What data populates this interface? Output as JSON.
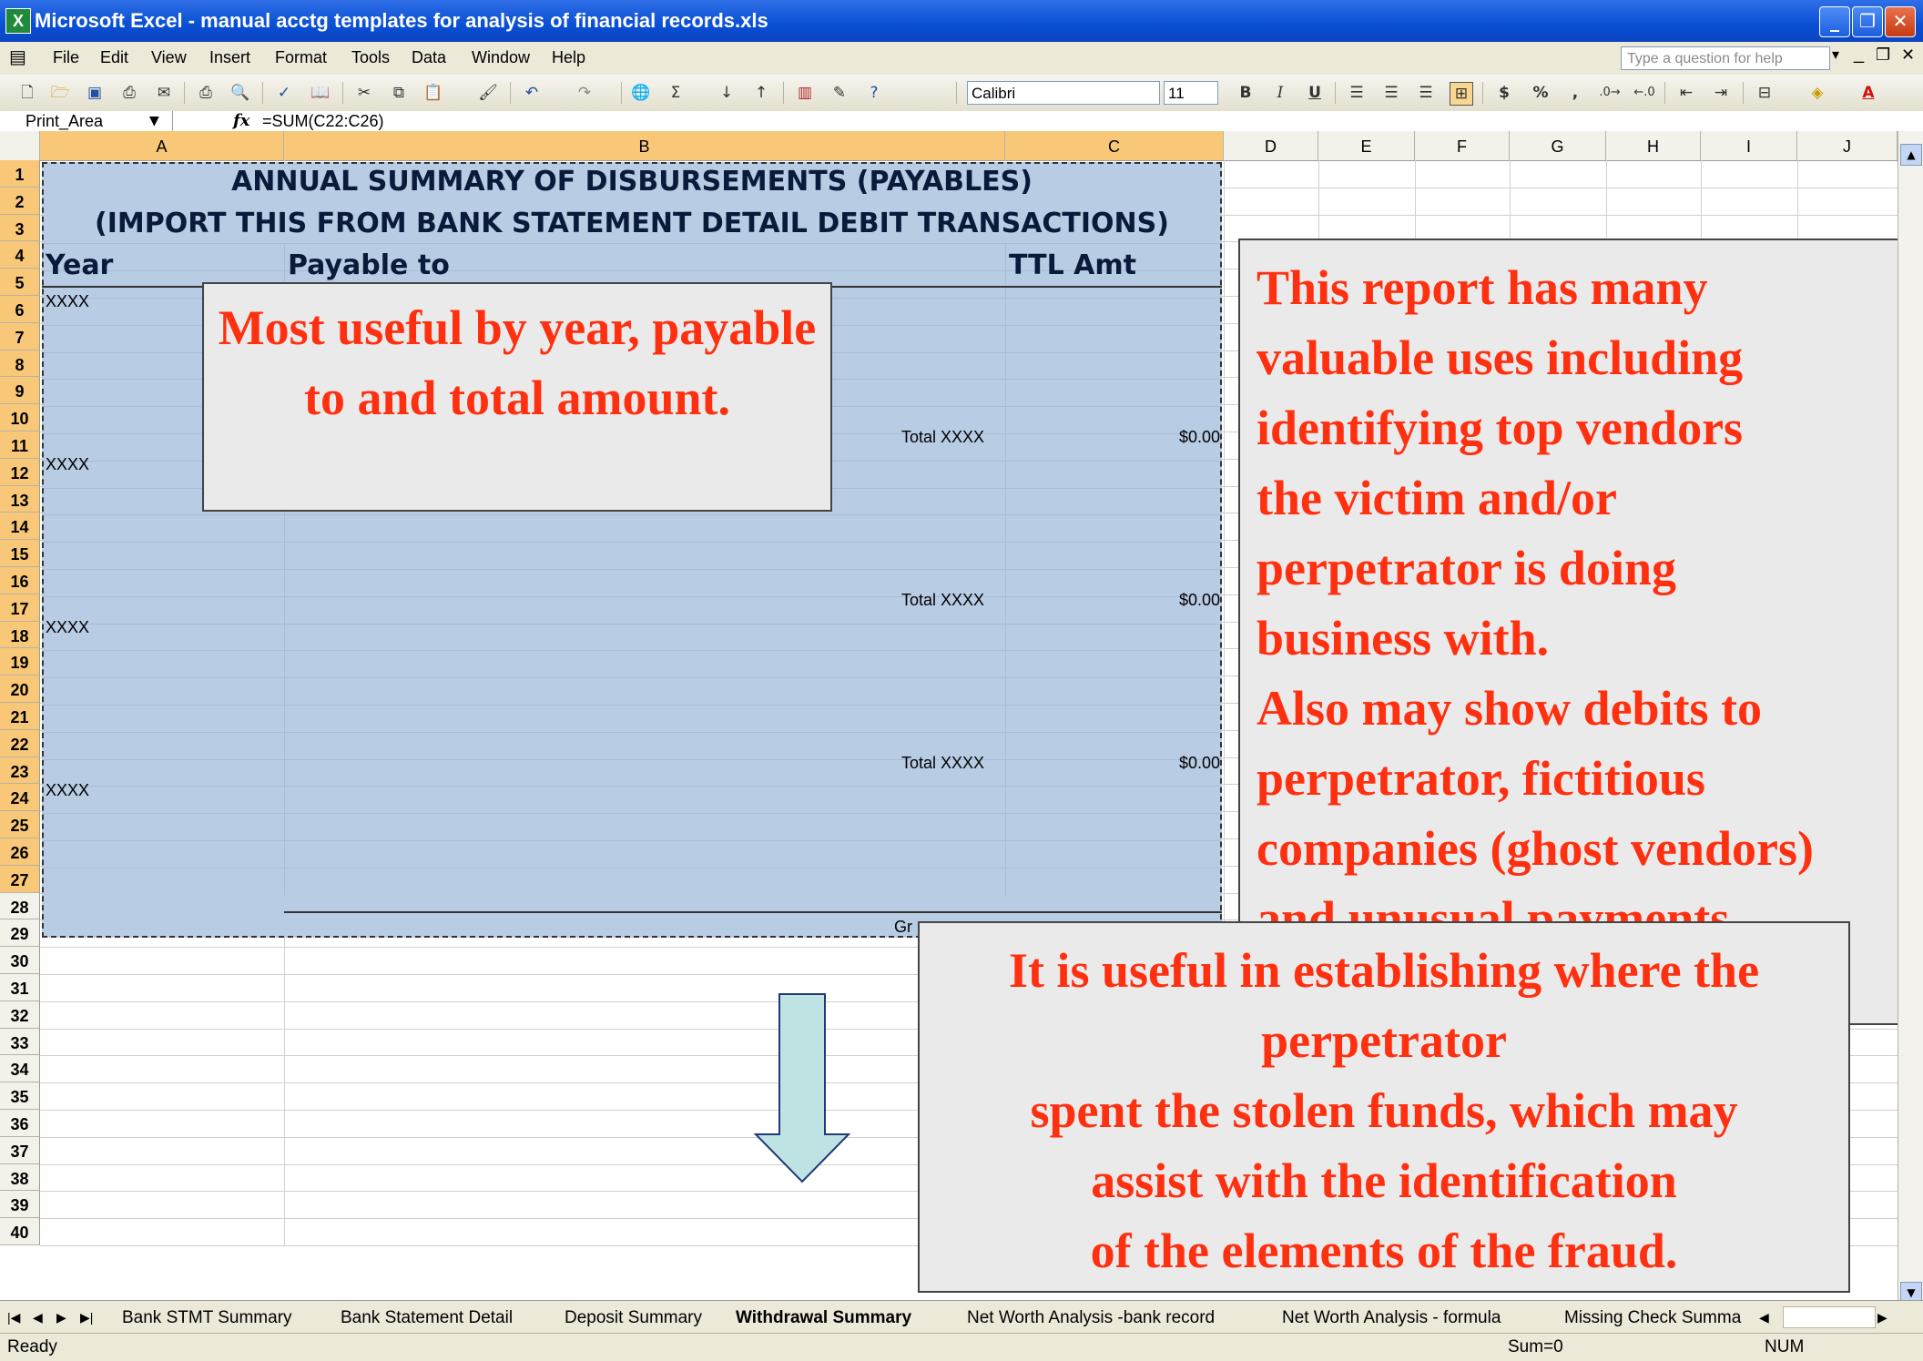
{
  "window": {
    "title": "Microsoft Excel - manual acctg templates for analysis of financial records.xls",
    "minimize": "_",
    "restore": "❐",
    "close": "✕"
  },
  "menu": {
    "items": [
      "File",
      "Edit",
      "View",
      "Insert",
      "Format",
      "Tools",
      "Data",
      "Window",
      "Help"
    ],
    "help_placeholder": "Type a question for help"
  },
  "toolbar": {
    "font": "Calibri",
    "size": "11",
    "bold": "B",
    "italic": "I",
    "underline": "U",
    "currency": "$",
    "percent": "%",
    "comma": ",",
    "sum": "Σ"
  },
  "formula_bar": {
    "name_box": "Print_Area",
    "fx": "fx",
    "formula": "=SUM(C22:C26)"
  },
  "columns": [
    "A",
    "B",
    "C",
    "D",
    "E",
    "F",
    "G",
    "H",
    "I",
    "J"
  ],
  "rows": [
    "1",
    "2",
    "3",
    "4",
    "5",
    "6",
    "7",
    "8",
    "9",
    "10",
    "11",
    "12",
    "13",
    "14",
    "15",
    "16",
    "17",
    "18",
    "19",
    "20",
    "21",
    "22",
    "23",
    "24",
    "25",
    "26",
    "27",
    "28",
    "29",
    "30",
    "31",
    "32",
    "33",
    "34",
    "35",
    "36",
    "37",
    "38",
    "39",
    "40"
  ],
  "sheet": {
    "title1": "ANNUAL SUMMARY OF DISBURSEMENTS (PAYABLES)",
    "title2": "(IMPORT THIS FROM BANK STATEMENT DETAIL DEBIT TRANSACTIONS)",
    "header_year": "Year",
    "header_payable": "Payable to",
    "header_amount": "TTL Amt",
    "year_cells": [
      "XXXX",
      "XXXX",
      "XXXX",
      "XXXX"
    ],
    "total_labels": [
      "Total XXXX",
      "Total XXXX",
      "Total XXXX"
    ],
    "total_values": [
      "$0.00",
      "$0.00",
      "$0.00"
    ],
    "grand_partial": "Gr"
  },
  "callouts": {
    "left": "Most useful by year, payable to and total amount.",
    "right_lines": [
      "This report has many",
      "valuable uses including",
      "identifying top vendors",
      "the victim and/or",
      "perpetrator is doing",
      "business with.",
      "Also may show debits to",
      "perpetrator, fictitious",
      "companies (ghost vendors)",
      "and unusual payments"
    ],
    "bottom_lines": [
      "It is useful in establishing where the",
      "perpetrator",
      "spent the stolen funds, which may",
      "assist with the identification",
      "of the elements of the fraud."
    ]
  },
  "tabs": [
    "Bank STMT Summary",
    "Bank Statement Detail",
    "Deposit Summary",
    "Withdrawal Summary",
    "Net Worth Analysis -bank record",
    "Net Worth Analysis - formula",
    "Missing Check Summa"
  ],
  "active_tab": "Withdrawal Summary",
  "status": {
    "ready": "Ready",
    "sum": "Sum=0",
    "num": "NUM"
  },
  "colors": {
    "selection": "#b8cce4",
    "callout_text": "#ff3010",
    "title_bar": "#0a4fd4"
  }
}
